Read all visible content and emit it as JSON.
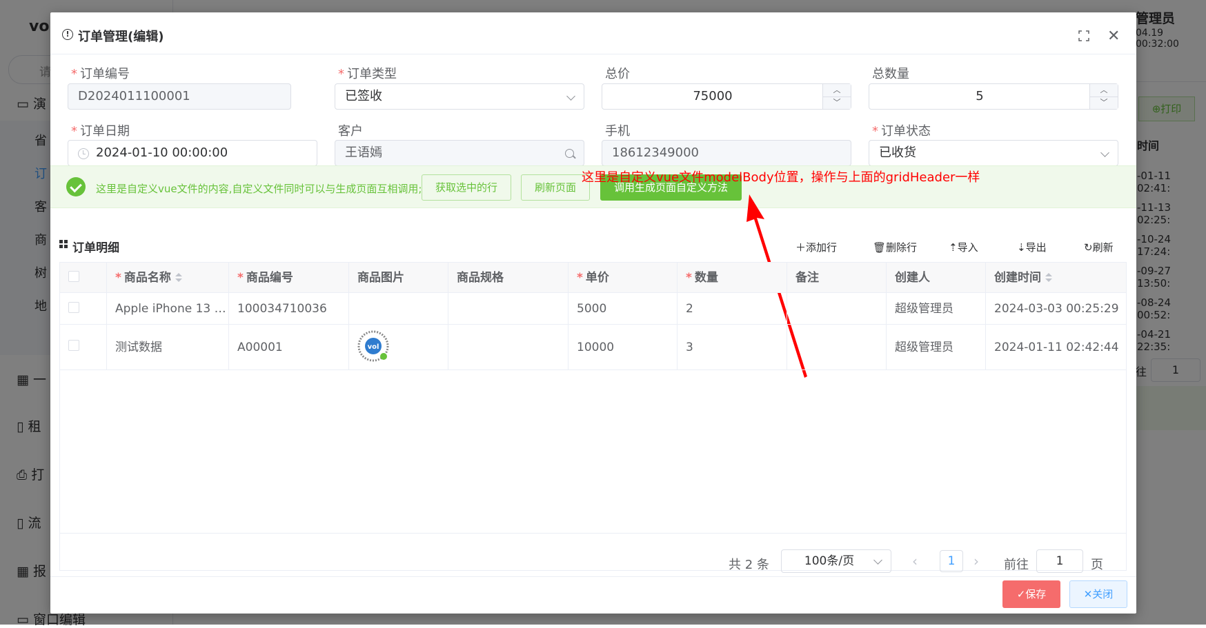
{
  "background": {
    "logo": "vol",
    "search_placeholder": "请",
    "menu": [
      {
        "label": "演",
        "icon": "monitor-icon"
      },
      {
        "label": "一",
        "icon": "calendar-icon"
      },
      {
        "label": "租",
        "icon": "tablet-icon"
      },
      {
        "label": "打",
        "icon": "printer-icon"
      },
      {
        "label": "流",
        "icon": "phone-icon"
      },
      {
        "label": "报",
        "icon": "calendar-icon"
      },
      {
        "label": "窗口编辑",
        "icon": "monitor-icon"
      }
    ],
    "submenu": [
      "省",
      "订",
      "客",
      "商",
      "树",
      "地"
    ],
    "user_name": "管理员",
    "date": "04.19 00:32:00",
    "print_btn": "⊕打印",
    "col_header": "时间",
    "cells": [
      "-01-11 02:41:",
      "-11-13 02:25:",
      "-10-24 17:24:",
      "-09-27 13:50:",
      "-08-24 00:52:",
      "-04-21 22:35:"
    ],
    "page_label": "往",
    "page_value": "1"
  },
  "dialog": {
    "title": "订单管理(编辑)",
    "form": {
      "order_no": {
        "label": "订单编号",
        "value": "D2024011100001"
      },
      "order_type": {
        "label": "订单类型",
        "value": "已签收"
      },
      "total_price": {
        "label": "总价",
        "value": "75000"
      },
      "total_qty": {
        "label": "总数量",
        "value": "5"
      },
      "order_date": {
        "label": "订单日期",
        "value": "2024-01-10 00:00:00"
      },
      "customer": {
        "label": "客户",
        "value": "王语嫣"
      },
      "phone": {
        "label": "手机",
        "value": "18612349000"
      },
      "order_status": {
        "label": "订单状态",
        "value": "已收货"
      }
    },
    "annotation": "这里是自定义vue文件modelBody位置，操作与上面的gridHeader一样",
    "greenbar": {
      "text": "这里是自定义vue文件的内容,自定义文件同时可以与生成页面互相调用;",
      "btn_selected": "获取选中的行",
      "btn_refresh": "刷新页面",
      "btn_call": "调用生成页面自定义方法"
    },
    "detail": {
      "title": "订单明细",
      "toolbar": {
        "add": "添加行",
        "delete": "删除行",
        "import": "导入",
        "export": "导出",
        "refresh": "刷新"
      },
      "columns": [
        "商品名称",
        "商品编号",
        "商品图片",
        "商品规格",
        "单价",
        "数量",
        "备注",
        "创建人",
        "创建时间"
      ],
      "rows": [
        {
          "name": "Apple iPhone 13 (…",
          "code": "100034710036",
          "spec": "",
          "price": "5000",
          "qty": "2",
          "remark": "",
          "creator": "超级管理员",
          "created": "2024-03-03 00:25:29"
        },
        {
          "name": "测试数据",
          "code": "A00001",
          "spec": "",
          "price": "10000",
          "qty": "3",
          "remark": "",
          "creator": "超级管理员",
          "created": "2024-01-11 02:42:44"
        }
      ]
    },
    "pagination": {
      "total": "共 2 条",
      "page_size": "100条/页",
      "current": "1",
      "goto_label": "前往",
      "goto_value": "1",
      "goto_suffix": "页"
    },
    "footer": {
      "save": "保存",
      "close": "关闭"
    }
  },
  "colors": {
    "accent": "#409eff",
    "success": "#67c23a",
    "danger": "#f56c6c",
    "annotation": "#ff0000"
  }
}
